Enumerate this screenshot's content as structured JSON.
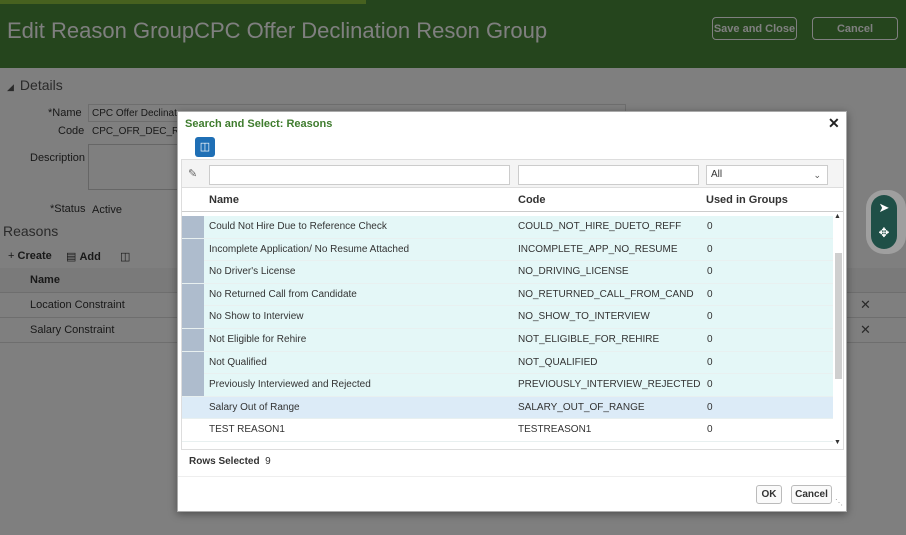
{
  "header": {
    "title": "Edit Reason GroupCPC Offer Declination Reson Group",
    "save_close_label": "Save and Close",
    "cancel_label": "Cancel"
  },
  "details": {
    "section_title": "Details",
    "name_label": "Name",
    "name_value": "CPC Offer Declinat",
    "code_label": "Code",
    "code_value": "CPC_OFR_DEC_RES",
    "description_label": "Description",
    "status_label": "Status",
    "status_value": "Active"
  },
  "reasons": {
    "section_title": "Reasons",
    "create_label": "Create",
    "add_label": "Add",
    "name_header": "Name",
    "rows": [
      {
        "name": "Location Constraint"
      },
      {
        "name": "Salary Constraint"
      }
    ]
  },
  "dialog": {
    "title": "Search and Select: Reasons",
    "filter_used_value": "All",
    "columns": {
      "name": "Name",
      "code": "Code",
      "used": "Used in Groups"
    },
    "rows": [
      {
        "name": "Could Not Hire Due to Reference Check",
        "code": "COULD_NOT_HIRE_DUETO_REFF",
        "used": "0",
        "selected": true
      },
      {
        "name": "Incomplete Application/ No Resume Attached",
        "code": "INCOMPLETE_APP_NO_RESUME",
        "used": "0",
        "selected": true
      },
      {
        "name": "No Driver's License",
        "code": "NO_DRIVING_LICENSE",
        "used": "0",
        "selected": true
      },
      {
        "name": "No Returned Call from Candidate",
        "code": "NO_RETURNED_CALL_FROM_CAND",
        "used": "0",
        "selected": true
      },
      {
        "name": "No Show to Interview",
        "code": "NO_SHOW_TO_INTERVIEW",
        "used": "0",
        "selected": true
      },
      {
        "name": "Not Eligible for Rehire",
        "code": "NOT_ELIGIBLE_FOR_REHIRE",
        "used": "0",
        "selected": true
      },
      {
        "name": "Not Qualified",
        "code": "NOT_QUALIFIED",
        "used": "0",
        "selected": true
      },
      {
        "name": "Previously Interviewed and Rejected",
        "code": "PREVIOUSLY_INTERVIEW_REJECTED",
        "used": "0",
        "selected": true
      },
      {
        "name": "Salary Out of Range",
        "code": "SALARY_OUT_OF_RANGE",
        "used": "0",
        "selected": true
      },
      {
        "name": "TEST REASON1",
        "code": "TESTREASON1",
        "used": "0",
        "selected": false
      }
    ],
    "rows_selected_label": "Rows Selected",
    "rows_selected_count": "9",
    "ok_label": "OK",
    "cancel_label": "Cancel"
  },
  "colors": {
    "header_green": "#4a8a3a",
    "title_green": "#3f7c2e",
    "selected_row": "#e4f7f7",
    "focus_row": "#dcebf7",
    "selector_cell": "#aebccd"
  }
}
